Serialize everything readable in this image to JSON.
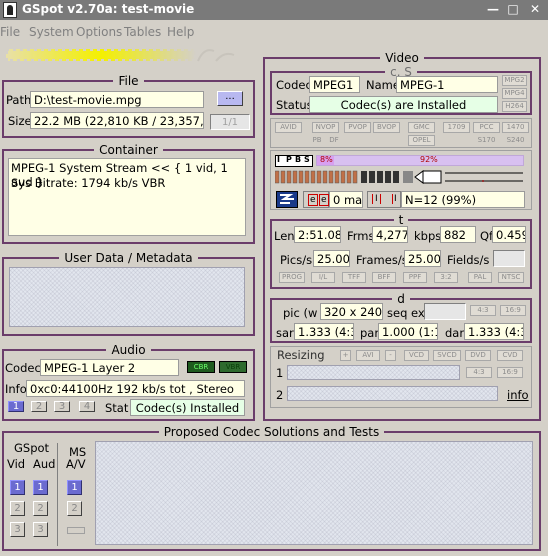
{
  "window": {
    "title": "GSpot v2.70a: test-movie"
  },
  "menu": [
    "File",
    "System",
    "Options",
    "Tables",
    "Help"
  ],
  "file": {
    "legend": "File",
    "path_label": "Path",
    "path_value": "D:\\test-movie.mpg",
    "browse_label": "...",
    "size_label": "Size",
    "size_value": "22.2 MB (22,810 KB / 23,357,440 b",
    "part": "1/1"
  },
  "container": {
    "legend": "Container",
    "line1": "MPEG-1 System Stream << { 1 vid, 1 aud }",
    "line2": "Sys Bitrate: 1794 kb/s VBR"
  },
  "userdata": {
    "legend": "User Data / Metadata"
  },
  "audio": {
    "legend": "Audio",
    "codec_label": "Codec",
    "codec_value": "MPEG-1 Layer 2",
    "cbr": "CBR",
    "vbr": "VBR",
    "info_label": "Info",
    "info_value": "0xc0:44100Hz  192 kb/s tot , Stereo",
    "streams": [
      "1",
      "2",
      "3",
      "4"
    ],
    "stat_label": "Stat",
    "stat_value": "Codec(s) Installed"
  },
  "video": {
    "legend": "Video",
    "cs_legend": "c, S",
    "codec_label": "Codec",
    "codec_value": "MPEG1",
    "name_label": "Name",
    "name_value": "MPEG-1",
    "tags_right": [
      "MPG2",
      "MPG4",
      "H264"
    ],
    "status_label": "Status",
    "status_value": "Codec(s) are Installed",
    "flags_row1": [
      "AVID",
      "NVOP",
      "PVOP",
      "BVOP",
      "GMC",
      "1709",
      "PCC",
      "1470"
    ],
    "flags_row2": [
      "PB",
      "DF",
      "OPEL",
      "S170",
      "S240"
    ],
    "frame_types": [
      "I",
      "P",
      "B",
      "S"
    ],
    "pct_left": "8%",
    "pct_right": "92%",
    "e_labels": [
      "e",
      "e"
    ],
    "max_value": "0 max",
    "i_labels": [
      "I",
      "I"
    ],
    "gop_value": "N=12 (99%)",
    "t_legend": "t",
    "len_label": "Len",
    "len_value": "2:51.080",
    "frms_label": "Frms",
    "frms_value": "4,277",
    "kbps_label": "kbps",
    "kbps_value": "882",
    "qf_label": "Qf",
    "qf_value": "0.459",
    "pics_label": "Pics/s",
    "pics_value": "25.000",
    "frames_label": "Frames/s",
    "frames_value": "25.000",
    "fields_label": "Fields/s",
    "t_tags": [
      "PROG",
      "I/L",
      "TFF",
      "BFF",
      "PPF",
      "3:2",
      "PAL",
      "NTSC"
    ],
    "d_legend": "d",
    "pic_label": "pic (w x",
    "pic_value": "320 x 240",
    "seq_label": "seq ext",
    "ar_tags": [
      "4:3",
      "16:9"
    ],
    "sar_label": "sar",
    "sar_value": "1.333 (4:3)",
    "par_label": "par",
    "par_value": "1.000 (1:1)",
    "dar_label": "dar",
    "dar_value": "1.333 (4:3)",
    "resizing_label": "Resizing",
    "resize_tags": [
      "+",
      "AVI",
      "-",
      "VCD",
      "SVCD",
      "DVD",
      "CVD"
    ],
    "r1": "1",
    "r2": "2",
    "r_tags": [
      "4:3",
      "16:9"
    ],
    "info_link": "info"
  },
  "proposed": {
    "legend": "Proposed Codec Solutions and Tests",
    "gspot_label": "GSpot",
    "vid_label": "Vid",
    "aud_label": "Aud",
    "ms_label": "MS",
    "av_label": "A/V",
    "nums": [
      "1",
      "2",
      "3"
    ]
  }
}
